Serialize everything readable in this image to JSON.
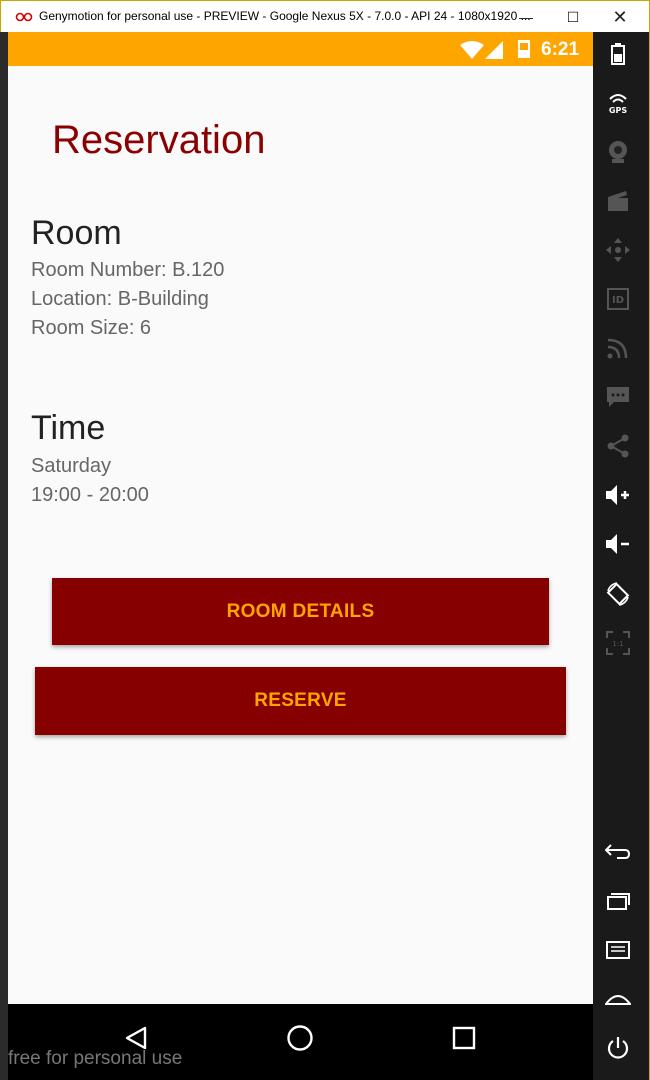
{
  "window": {
    "title": "Genymotion for personal use - PREVIEW - Google Nexus 5X - 7.0.0 - API 24 - 1080x1920 ...",
    "minimize_glyph": "—",
    "maximize_glyph": "☐",
    "close_glyph": "✕"
  },
  "statusbar": {
    "time": "6:21"
  },
  "page": {
    "title": "Reservation",
    "room": {
      "heading": "Room",
      "number": "Room Number: B.120",
      "location": "Location: B-Building",
      "size": "Room Size: 6"
    },
    "time": {
      "heading": "Time",
      "day": "Saturday",
      "slot": "19:00 - 20:00"
    },
    "buttons": {
      "details": "ROOM DETAILS",
      "reserve": "RESERVE"
    }
  },
  "footer": {
    "watermark": "free for personal use"
  },
  "toolbar": {
    "items": [
      "battery-icon",
      "gps-icon",
      "webcam-icon",
      "capture-icon",
      "dpad-icon",
      "identifiers-icon",
      "network-icon",
      "sms-icon",
      "share-icon",
      "volume-up-icon",
      "volume-down-icon",
      "rotate-icon",
      "pixel-perfect-icon",
      "back-icon",
      "recent-apps-icon",
      "menu-icon",
      "home-icon",
      "power-icon"
    ]
  },
  "colors": {
    "accent": "#ffa500",
    "primary": "#870000",
    "title": "#8b0000"
  }
}
